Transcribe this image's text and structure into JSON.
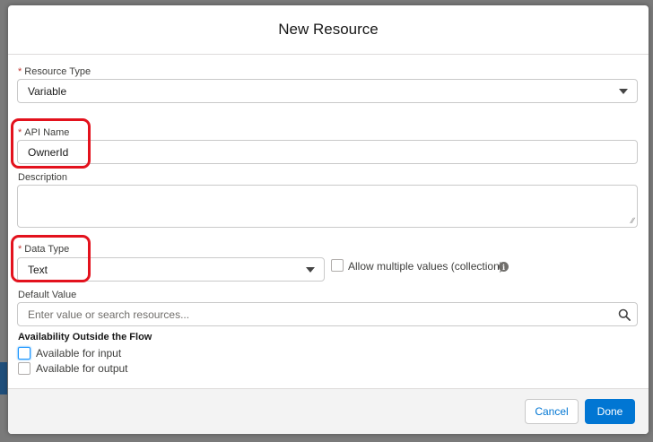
{
  "modal": {
    "title": "New Resource"
  },
  "fields": {
    "resource_type": {
      "label": "Resource Type",
      "required": "*",
      "value": "Variable"
    },
    "api_name": {
      "label": "API Name",
      "required": "*",
      "value": "OwnerId"
    },
    "description": {
      "label": "Description",
      "value": ""
    },
    "data_type": {
      "label": "Data Type",
      "required": "*",
      "value": "Text"
    },
    "allow_multiple": {
      "label": "Allow multiple values (collection)",
      "checked": false
    },
    "default_value": {
      "label": "Default Value",
      "placeholder": "Enter value or search resources..."
    }
  },
  "availability": {
    "title": "Availability Outside the Flow",
    "input_label": "Available for input",
    "output_label": "Available for output"
  },
  "footer": {
    "cancel_label": "Cancel",
    "done_label": "Done"
  },
  "colors": {
    "brand": "#0176d3",
    "required": "#c23934",
    "highlight": "#e3121d"
  },
  "icons": [
    "chevron-down-icon",
    "resize-handle-icon",
    "info-icon",
    "search-icon"
  ]
}
